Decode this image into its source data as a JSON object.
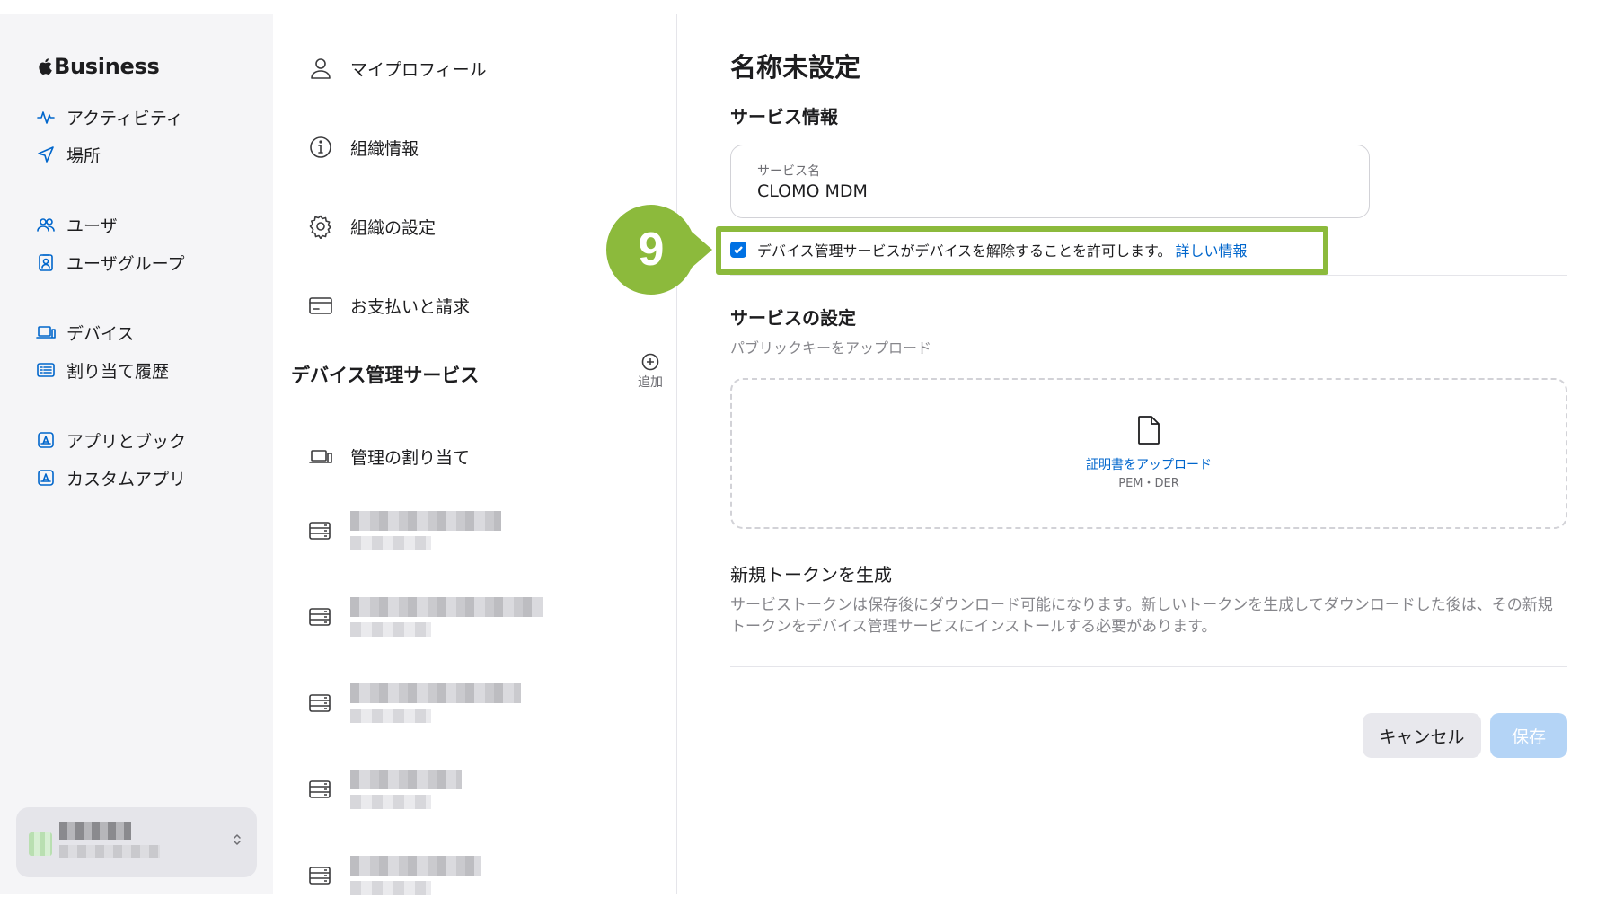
{
  "sidebar": {
    "brand": "Business",
    "items": [
      {
        "label": "アクティビティ",
        "icon": "activity-icon"
      },
      {
        "label": "場所",
        "icon": "location-arrow-icon"
      },
      {
        "label": "ユーザ",
        "icon": "users-icon"
      },
      {
        "label": "ユーザグループ",
        "icon": "user-group-icon"
      },
      {
        "label": "デバイス",
        "icon": "laptop-icon"
      },
      {
        "label": "割り当て履歴",
        "icon": "history-list-icon"
      },
      {
        "label": "アプリとブック",
        "icon": "app-store-icon"
      },
      {
        "label": "カスタムアプリ",
        "icon": "custom-app-icon"
      }
    ],
    "account_chevron": "⌃⌄"
  },
  "settings_menu": {
    "items": [
      {
        "label": "マイプロフィール",
        "icon": "person-icon"
      },
      {
        "label": "組織情報",
        "icon": "info-icon"
      },
      {
        "label": "組織の設定",
        "icon": "gear-icon"
      },
      {
        "label": "お支払いと請求",
        "icon": "credit-card-icon"
      }
    ],
    "device_management_title": "デバイス管理サービス",
    "add_label": "追加",
    "assignment_label": "管理の割り当て"
  },
  "main": {
    "title": "名称未設定",
    "service_info_heading": "サービス情報",
    "service_name_label": "サービス名",
    "service_name_value": "CLOMO MDM",
    "step_number": "9",
    "checkbox_checked": true,
    "checkbox_label": "デバイス管理サービスがデバイスを解除することを許可します。",
    "checkbox_link": "詳しい情報",
    "service_settings_heading": "サービスの設定",
    "public_key_subtitle": "パブリックキーをアップロード",
    "upload_label": "証明書をアップロード",
    "upload_formats": "PEM・DER",
    "new_token_heading": "新規トークンを生成",
    "new_token_description": "サービストークンは保存後にダウンロード可能になります。新しいトークンを生成してダウンロードした後は、その新規トークンをデバイス管理サービスにインストールする必要があります。",
    "cancel_label": "キャンセル",
    "save_label": "保存"
  },
  "colors": {
    "accent": "#0066cc",
    "highlight_green": "#8cba3c",
    "sidebar_bg": "#f5f5f7",
    "save_disabled": "#b4d4f6"
  }
}
